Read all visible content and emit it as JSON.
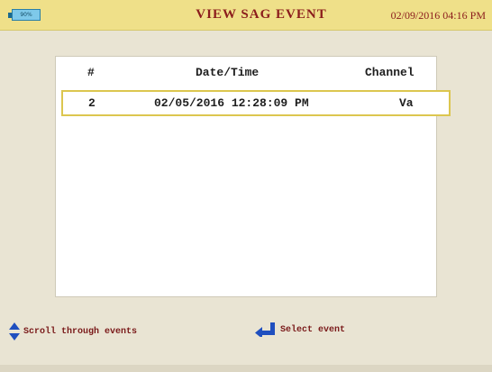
{
  "header": {
    "battery_label": "90%",
    "title": "VIEW SAG EVENT",
    "datetime": "02/09/2016 04:16 PM"
  },
  "table": {
    "columns": [
      "#",
      "Date/Time",
      "Channel"
    ],
    "rows": [
      {
        "number": "2",
        "datetime": "02/05/2016 12:28:09 PM",
        "channel": "Va"
      }
    ]
  },
  "footer": {
    "scroll_label": "Scroll through events",
    "select_label": "Select event"
  },
  "colors": {
    "header_bar": "#efe089",
    "title_text": "#8b1c1c",
    "row_highlight": "#dcc64f",
    "icon_blue": "#1f4fbf"
  },
  "icons": {
    "battery": "battery-icon",
    "scroll": "up-down-arrows-icon",
    "select": "enter-key-icon"
  }
}
